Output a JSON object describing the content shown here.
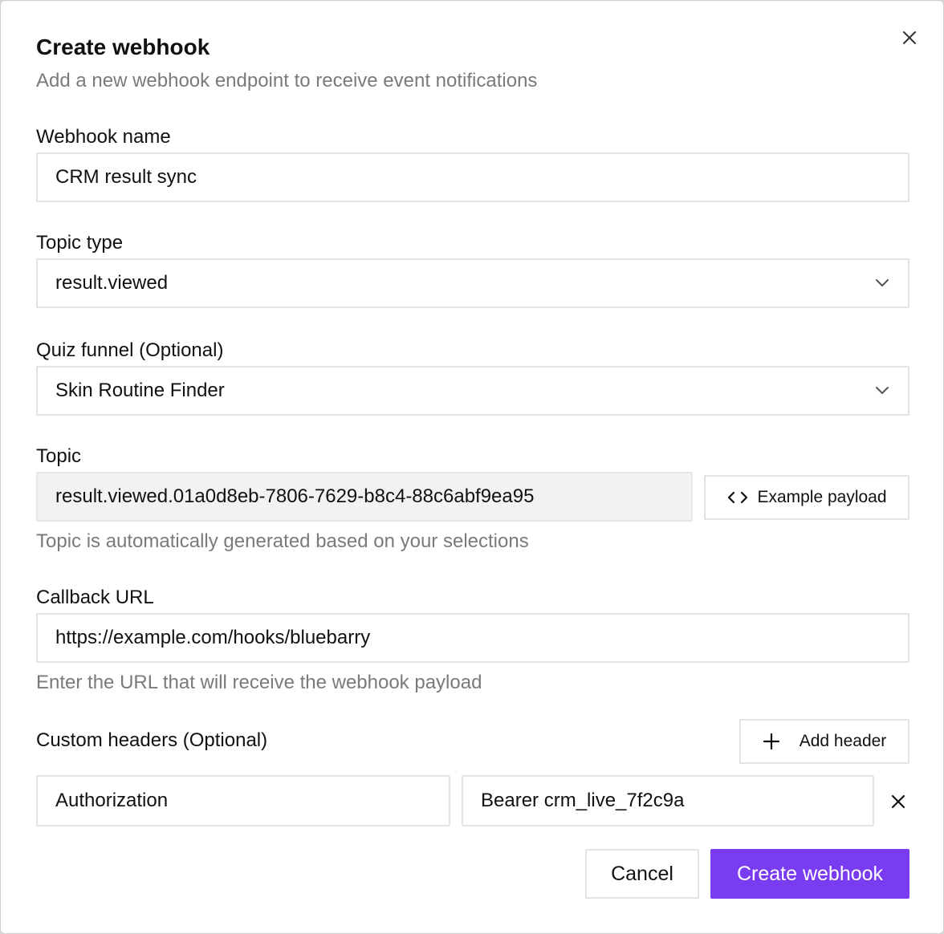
{
  "dialog": {
    "title": "Create webhook",
    "subtitle": "Add a new webhook endpoint to receive event notifications"
  },
  "webhook_name": {
    "label": "Webhook name",
    "value": "CRM result sync"
  },
  "topic_type": {
    "label": "Topic type",
    "value": "result.viewed"
  },
  "quiz_funnel": {
    "label": "Quiz funnel (Optional)",
    "value": "Skin Routine Finder"
  },
  "topic": {
    "label": "Topic",
    "value": "result.viewed.01a0d8eb-7806-7629-b8c4-88c6abf9ea95",
    "helper": "Topic is automatically generated based on your selections",
    "example_payload_label": "Example payload"
  },
  "callback_url": {
    "label": "Callback URL",
    "value": "https://example.com/hooks/bluebarry",
    "helper": "Enter the URL that will receive the webhook payload"
  },
  "custom_headers": {
    "label": "Custom headers (Optional)",
    "add_label": "Add header",
    "rows": [
      {
        "key": "Authorization",
        "value": "Bearer crm_live_7f2c9a"
      }
    ]
  },
  "actions": {
    "cancel_label": "Cancel",
    "submit_label": "Create webhook"
  },
  "colors": {
    "primary": "#7a3cf0"
  }
}
